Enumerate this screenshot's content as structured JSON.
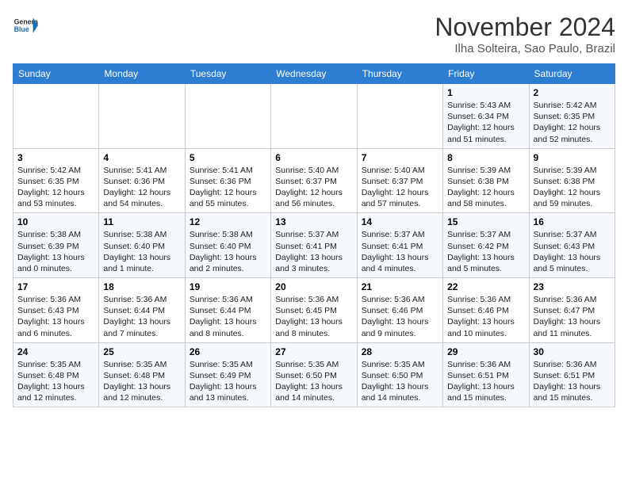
{
  "header": {
    "logo_line1": "General",
    "logo_line2": "Blue",
    "month": "November 2024",
    "location": "Ilha Solteira, Sao Paulo, Brazil"
  },
  "weekdays": [
    "Sunday",
    "Monday",
    "Tuesday",
    "Wednesday",
    "Thursday",
    "Friday",
    "Saturday"
  ],
  "weeks": [
    [
      {
        "day": "",
        "info": ""
      },
      {
        "day": "",
        "info": ""
      },
      {
        "day": "",
        "info": ""
      },
      {
        "day": "",
        "info": ""
      },
      {
        "day": "",
        "info": ""
      },
      {
        "day": "1",
        "info": "Sunrise: 5:43 AM\nSunset: 6:34 PM\nDaylight: 12 hours and 51 minutes."
      },
      {
        "day": "2",
        "info": "Sunrise: 5:42 AM\nSunset: 6:35 PM\nDaylight: 12 hours and 52 minutes."
      }
    ],
    [
      {
        "day": "3",
        "info": "Sunrise: 5:42 AM\nSunset: 6:35 PM\nDaylight: 12 hours and 53 minutes."
      },
      {
        "day": "4",
        "info": "Sunrise: 5:41 AM\nSunset: 6:36 PM\nDaylight: 12 hours and 54 minutes."
      },
      {
        "day": "5",
        "info": "Sunrise: 5:41 AM\nSunset: 6:36 PM\nDaylight: 12 hours and 55 minutes."
      },
      {
        "day": "6",
        "info": "Sunrise: 5:40 AM\nSunset: 6:37 PM\nDaylight: 12 hours and 56 minutes."
      },
      {
        "day": "7",
        "info": "Sunrise: 5:40 AM\nSunset: 6:37 PM\nDaylight: 12 hours and 57 minutes."
      },
      {
        "day": "8",
        "info": "Sunrise: 5:39 AM\nSunset: 6:38 PM\nDaylight: 12 hours and 58 minutes."
      },
      {
        "day": "9",
        "info": "Sunrise: 5:39 AM\nSunset: 6:38 PM\nDaylight: 12 hours and 59 minutes."
      }
    ],
    [
      {
        "day": "10",
        "info": "Sunrise: 5:38 AM\nSunset: 6:39 PM\nDaylight: 13 hours and 0 minutes."
      },
      {
        "day": "11",
        "info": "Sunrise: 5:38 AM\nSunset: 6:40 PM\nDaylight: 13 hours and 1 minute."
      },
      {
        "day": "12",
        "info": "Sunrise: 5:38 AM\nSunset: 6:40 PM\nDaylight: 13 hours and 2 minutes."
      },
      {
        "day": "13",
        "info": "Sunrise: 5:37 AM\nSunset: 6:41 PM\nDaylight: 13 hours and 3 minutes."
      },
      {
        "day": "14",
        "info": "Sunrise: 5:37 AM\nSunset: 6:41 PM\nDaylight: 13 hours and 4 minutes."
      },
      {
        "day": "15",
        "info": "Sunrise: 5:37 AM\nSunset: 6:42 PM\nDaylight: 13 hours and 5 minutes."
      },
      {
        "day": "16",
        "info": "Sunrise: 5:37 AM\nSunset: 6:43 PM\nDaylight: 13 hours and 5 minutes."
      }
    ],
    [
      {
        "day": "17",
        "info": "Sunrise: 5:36 AM\nSunset: 6:43 PM\nDaylight: 13 hours and 6 minutes."
      },
      {
        "day": "18",
        "info": "Sunrise: 5:36 AM\nSunset: 6:44 PM\nDaylight: 13 hours and 7 minutes."
      },
      {
        "day": "19",
        "info": "Sunrise: 5:36 AM\nSunset: 6:44 PM\nDaylight: 13 hours and 8 minutes."
      },
      {
        "day": "20",
        "info": "Sunrise: 5:36 AM\nSunset: 6:45 PM\nDaylight: 13 hours and 8 minutes."
      },
      {
        "day": "21",
        "info": "Sunrise: 5:36 AM\nSunset: 6:46 PM\nDaylight: 13 hours and 9 minutes."
      },
      {
        "day": "22",
        "info": "Sunrise: 5:36 AM\nSunset: 6:46 PM\nDaylight: 13 hours and 10 minutes."
      },
      {
        "day": "23",
        "info": "Sunrise: 5:36 AM\nSunset: 6:47 PM\nDaylight: 13 hours and 11 minutes."
      }
    ],
    [
      {
        "day": "24",
        "info": "Sunrise: 5:35 AM\nSunset: 6:48 PM\nDaylight: 13 hours and 12 minutes."
      },
      {
        "day": "25",
        "info": "Sunrise: 5:35 AM\nSunset: 6:48 PM\nDaylight: 13 hours and 12 minutes."
      },
      {
        "day": "26",
        "info": "Sunrise: 5:35 AM\nSunset: 6:49 PM\nDaylight: 13 hours and 13 minutes."
      },
      {
        "day": "27",
        "info": "Sunrise: 5:35 AM\nSunset: 6:50 PM\nDaylight: 13 hours and 14 minutes."
      },
      {
        "day": "28",
        "info": "Sunrise: 5:35 AM\nSunset: 6:50 PM\nDaylight: 13 hours and 14 minutes."
      },
      {
        "day": "29",
        "info": "Sunrise: 5:36 AM\nSunset: 6:51 PM\nDaylight: 13 hours and 15 minutes."
      },
      {
        "day": "30",
        "info": "Sunrise: 5:36 AM\nSunset: 6:51 PM\nDaylight: 13 hours and 15 minutes."
      }
    ]
  ]
}
